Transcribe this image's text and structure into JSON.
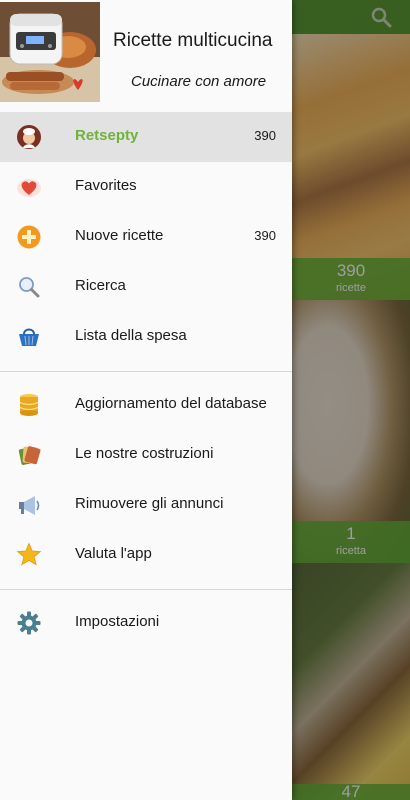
{
  "drawer": {
    "title": "Ricette multicucina",
    "subtitle": "Cucinare con amore",
    "sections": [
      [
        {
          "icon": "chef-avatar-icon",
          "label": "Retsepty",
          "count": "390",
          "active": true
        },
        {
          "icon": "heart-icon",
          "label": "Favorites",
          "count": ""
        },
        {
          "icon": "plus-circle-icon",
          "label": "Nuove ricette",
          "count": "390"
        },
        {
          "icon": "magnifier-icon",
          "label": "Ricerca",
          "count": ""
        },
        {
          "icon": "shopping-basket-icon",
          "label": "Lista della spesa",
          "count": ""
        }
      ],
      [
        {
          "icon": "database-icon",
          "label": "Aggiornamento del database",
          "count": ""
        },
        {
          "icon": "apps-stack-icon",
          "label": "Le nostre costruzioni",
          "count": ""
        },
        {
          "icon": "megaphone-icon",
          "label": "Rimuovere gli annunci",
          "count": ""
        },
        {
          "icon": "star-icon",
          "label": "Valuta l'app",
          "count": ""
        }
      ],
      [
        {
          "icon": "gear-icon",
          "label": "Impostazioni",
          "count": ""
        }
      ]
    ]
  },
  "background": {
    "cards": [
      {
        "count": "390",
        "unit": "ricette"
      },
      {
        "count": "1",
        "unit": "ricetta"
      },
      {
        "count": "47",
        "unit": ""
      }
    ]
  },
  "colors": {
    "accent": "#6fb33d",
    "active_bg": "#e2e2e2",
    "topbar": "#5d9a35",
    "strip": "#68b43a"
  }
}
